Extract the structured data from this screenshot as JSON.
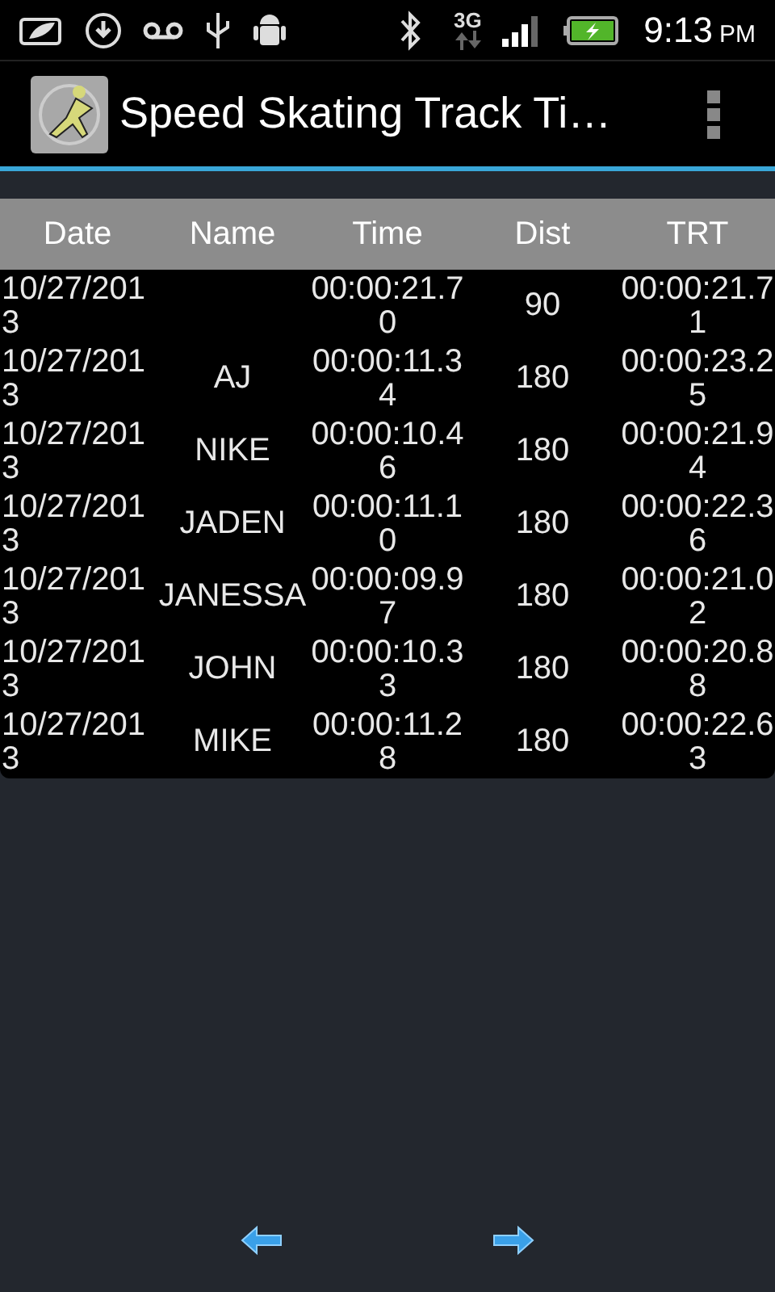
{
  "status_bar": {
    "time": "9:13",
    "ampm": "PM",
    "network": "3G"
  },
  "app_bar": {
    "title": "Speed Skating Track Ti…"
  },
  "table": {
    "columns": [
      "Date",
      "Name",
      "Time",
      "Dist",
      "TRT"
    ],
    "rows": [
      [
        "10/27/2013",
        "",
        "00:00:21.70",
        "90",
        "00:00:21.71"
      ],
      [
        "10/27/2013",
        "AJ",
        "00:00:11.34",
        "180",
        "00:00:23.25"
      ],
      [
        "10/27/2013",
        "NIKE",
        "00:00:10.46",
        "180",
        "00:00:21.94"
      ],
      [
        "10/27/2013",
        "JADEN",
        "00:00:11.10",
        "180",
        "00:00:22.36"
      ],
      [
        "10/27/2013",
        "JANESSA",
        "00:00:09.97",
        "180",
        "00:00:21.02"
      ],
      [
        "10/27/2013",
        "JOHN",
        "00:00:10.33",
        "180",
        "00:00:20.88"
      ],
      [
        "10/27/2013",
        "MIKE",
        "00:00:11.28",
        "180",
        "00:00:22.63"
      ]
    ]
  }
}
